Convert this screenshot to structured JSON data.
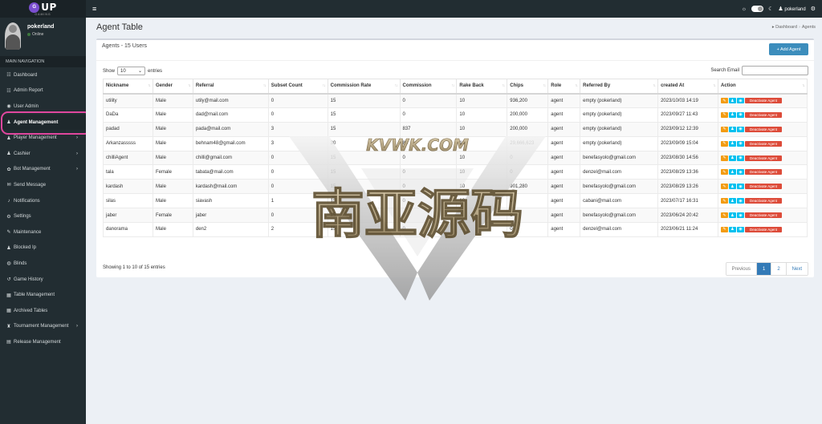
{
  "logo": {
    "badge": "G",
    "text": "UP",
    "sub": "GAMING"
  },
  "user": {
    "name": "pokerland",
    "status": "Online"
  },
  "nav": {
    "header": "MAIN NAVIGATION",
    "items": [
      {
        "label": "Dashboard",
        "icon": "chart-icon",
        "glyph": "☷",
        "chev": ""
      },
      {
        "label": "Admin Report",
        "icon": "report-icon",
        "glyph": "☷",
        "chev": ""
      },
      {
        "label": "User Admin",
        "icon": "user-circle-icon",
        "glyph": "◉",
        "chev": ""
      },
      {
        "label": "Agent Management",
        "icon": "users-icon",
        "glyph": "♟",
        "chev": ""
      },
      {
        "label": "Player Management",
        "icon": "player-icon",
        "glyph": "♟",
        "chev": "›"
      },
      {
        "label": "Cashier",
        "icon": "cashier-icon",
        "glyph": "♟",
        "chev": "›"
      },
      {
        "label": "Bot Management",
        "icon": "bot-icon",
        "glyph": "✿",
        "chev": "›"
      },
      {
        "label": "Send Message",
        "icon": "message-icon",
        "glyph": "✉",
        "chev": ""
      },
      {
        "label": "Notifications",
        "icon": "bell-icon",
        "glyph": "♪",
        "chev": ""
      },
      {
        "label": "Settings",
        "icon": "gear-icon",
        "glyph": "⚙",
        "chev": ""
      },
      {
        "label": "Maintenance",
        "icon": "wrench-icon",
        "glyph": "✎",
        "chev": ""
      },
      {
        "label": "Blocked Ip",
        "icon": "block-icon",
        "glyph": "♟",
        "chev": ""
      },
      {
        "label": "Blinds",
        "icon": "blinds-icon",
        "glyph": "◍",
        "chev": ""
      },
      {
        "label": "Game History",
        "icon": "history-icon",
        "glyph": "↺",
        "chev": ""
      },
      {
        "label": "Table Management",
        "icon": "table-icon",
        "glyph": "▦",
        "chev": ""
      },
      {
        "label": "Archived Tables",
        "icon": "archive-icon",
        "glyph": "▦",
        "chev": ""
      },
      {
        "label": "Tournament Management",
        "icon": "trophy-icon",
        "glyph": "♜",
        "chev": "›"
      },
      {
        "label": "Release Management",
        "icon": "release-icon",
        "glyph": "▤",
        "chev": ""
      }
    ]
  },
  "topbar": {
    "username": "pokerland"
  },
  "page": {
    "title": "Agent Table",
    "breadcrumb_home": "Dashboard",
    "breadcrumb_current": "Agents"
  },
  "box": {
    "title": "Agents - 15 Users",
    "add_label": "+ Add Agent"
  },
  "length": {
    "show": "Show",
    "value": "10",
    "entries": "entries"
  },
  "search": {
    "label": "Search Email",
    "value": ""
  },
  "table": {
    "columns": [
      "Nickname",
      "Gender",
      "Referral",
      "Subset Count",
      "Commission Rate",
      "Commission",
      "Rake Back",
      "Chips",
      "Role",
      "Referred By",
      "created At",
      "Action"
    ],
    "rows": [
      [
        "utility",
        "Male",
        "utily@mail.com",
        "0",
        "15",
        "0",
        "10",
        "936,200",
        "agent",
        "empty (pokerland)",
        "2023/10/03  14:19"
      ],
      [
        "DaDa",
        "Male",
        "dad@mail.com",
        "0",
        "15",
        "0",
        "10",
        "200,000",
        "agent",
        "empty (pokerland)",
        "2023/09/27  11:43"
      ],
      [
        "padad",
        "Male",
        "pada@mail.com",
        "3",
        "15",
        "837",
        "10",
        "200,000",
        "agent",
        "empty (pokerland)",
        "2023/09/12  12:39"
      ],
      [
        "Arkanzasssss",
        "Male",
        "behnam48@gmail.com",
        "3",
        "30",
        "80",
        "10",
        "29,666,623",
        "agent",
        "empty (pokerland)",
        "2023/09/09  15:04"
      ],
      [
        "chilliAgent",
        "Male",
        "chilli@gmail.com",
        "0",
        "15",
        "0",
        "10",
        "0",
        "agent",
        "benefasyolo@gmail.com",
        "2023/08/30  14:56"
      ],
      [
        "tala",
        "Female",
        "tabata@mail.com",
        "0",
        "15",
        "0",
        "10",
        "0",
        "agent",
        "denzel@mail.com",
        "2023/08/29  13:36"
      ],
      [
        "kardash",
        "Male",
        "kardash@mail.com",
        "0",
        "15",
        "0",
        "10",
        "901,280",
        "agent",
        "benefasyolo@gmail.com",
        "2023/08/29  13:26"
      ],
      [
        "silas",
        "Male",
        "siavash",
        "1",
        "15",
        "0",
        "10",
        "0",
        "agent",
        "cabani@mail.com",
        "2023/07/17  16:31"
      ],
      [
        "jaber",
        "Female",
        "jaber",
        "0",
        "15",
        "0",
        "10",
        "0",
        "agent",
        "benefasyolo@gmail.com",
        "2023/06/24  20:42"
      ],
      [
        "danorama",
        "Male",
        "den2",
        "2",
        "15",
        "0",
        "10",
        "0",
        "agent",
        "denzel@mail.com",
        "2023/06/21  11:24"
      ]
    ],
    "deactivate_label": "Deactivate Agent"
  },
  "footer": {
    "info": "Showing 1 to 10 of 15 entries"
  },
  "pager": {
    "prev": "Previous",
    "p1": "1",
    "p2": "2",
    "next": "Next"
  },
  "watermark": {
    "top": "KVWK.COM",
    "main": "南亚源码"
  },
  "colors": {
    "sidebar": "#222d32",
    "primary": "#3c8dbc",
    "danger": "#dd4b39",
    "warning": "#f39c12",
    "info": "#00c0ef",
    "highlight": "#e0479e"
  }
}
